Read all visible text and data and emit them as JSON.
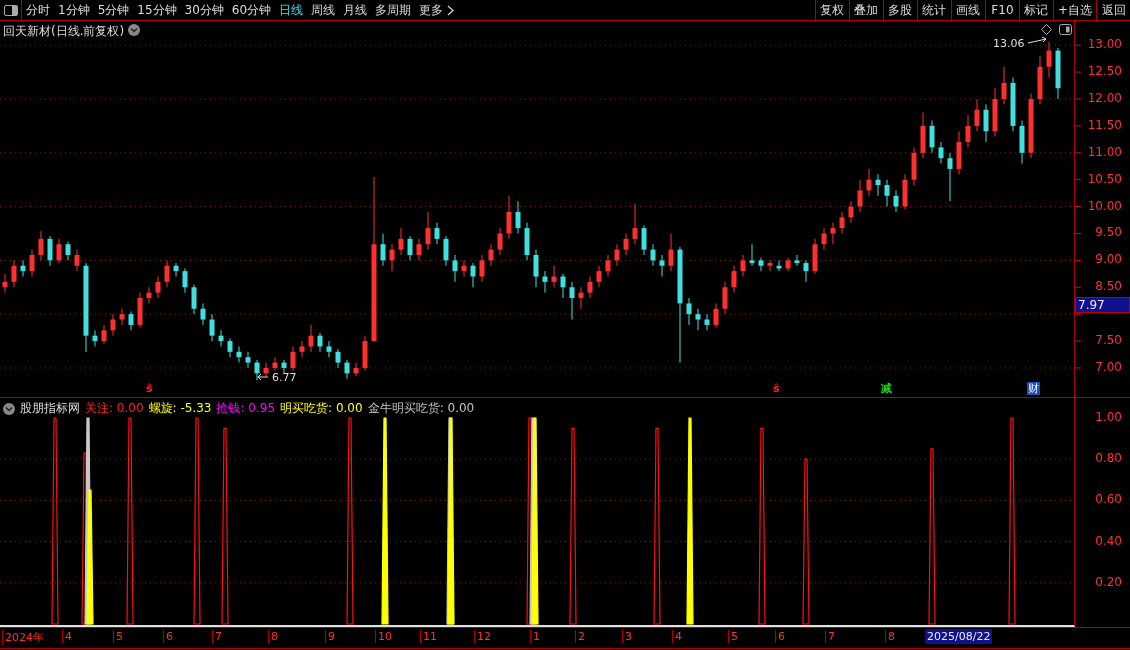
{
  "toolbar": {
    "periods": [
      {
        "label": "分时",
        "selected": false
      },
      {
        "label": "1分钟",
        "selected": false
      },
      {
        "label": "5分钟",
        "selected": false
      },
      {
        "label": "15分钟",
        "selected": false
      },
      {
        "label": "30分钟",
        "selected": false
      },
      {
        "label": "60分钟",
        "selected": false
      },
      {
        "label": "日线",
        "selected": true
      },
      {
        "label": "周线",
        "selected": false
      },
      {
        "label": "月线",
        "selected": false
      },
      {
        "label": "多周期",
        "selected": false
      }
    ],
    "more": "更多",
    "actions": [
      "复权",
      "叠加",
      "多股",
      "统计",
      "画线",
      "F10",
      "标记",
      "+自选",
      "返回"
    ]
  },
  "price_chart": {
    "title": "回天新材(日线.前复权)",
    "chart_data": {
      "type": "candlestick",
      "ylim": [
        6.46,
        13.45
      ],
      "grid": true,
      "yticks": [
        {
          "value": 13,
          "label": "13.00"
        },
        {
          "value": 12.5,
          "label": "12.50"
        },
        {
          "value": 12,
          "label": "12.00"
        },
        {
          "value": 11.5,
          "label": "11.50"
        },
        {
          "value": 11,
          "label": "11.00"
        },
        {
          "value": 10.5,
          "label": "10.50"
        },
        {
          "value": 10,
          "label": "10.00"
        },
        {
          "value": 9.5,
          "label": "9.50"
        },
        {
          "value": 9,
          "label": "9.00"
        },
        {
          "value": 8.5,
          "label": "8.50"
        },
        {
          "value": 7.5,
          "label": "7.50"
        },
        {
          "value": 7,
          "label": "7.00"
        }
      ],
      "ohlc": [
        [
          8.5,
          8.75,
          8.4,
          8.6
        ],
        [
          8.6,
          9.0,
          8.5,
          8.9
        ],
        [
          8.9,
          9.0,
          8.7,
          8.8
        ],
        [
          8.8,
          9.2,
          8.7,
          9.1
        ],
        [
          9.1,
          9.55,
          9.0,
          9.4
        ],
        [
          9.4,
          9.45,
          8.9,
          9.0
        ],
        [
          9.0,
          9.4,
          8.95,
          9.3
        ],
        [
          9.3,
          9.35,
          9.0,
          9.1
        ],
        [
          8.9,
          9.2,
          8.8,
          9.1
        ],
        [
          8.9,
          8.95,
          7.3,
          7.6
        ],
        [
          7.6,
          7.7,
          7.4,
          7.5
        ],
        [
          7.5,
          7.8,
          7.45,
          7.7
        ],
        [
          7.7,
          8.0,
          7.6,
          7.9
        ],
        [
          7.9,
          8.1,
          7.8,
          8.0
        ],
        [
          8.0,
          8.05,
          7.7,
          7.8
        ],
        [
          7.8,
          8.4,
          7.75,
          8.3
        ],
        [
          8.3,
          8.5,
          8.2,
          8.4
        ],
        [
          8.4,
          8.7,
          8.3,
          8.6
        ],
        [
          8.6,
          9.0,
          8.5,
          8.9
        ],
        [
          8.9,
          8.95,
          8.7,
          8.8
        ],
        [
          8.8,
          8.85,
          8.4,
          8.5
        ],
        [
          8.5,
          8.55,
          8.0,
          8.1
        ],
        [
          8.1,
          8.2,
          7.8,
          7.9
        ],
        [
          7.9,
          8.0,
          7.5,
          7.6
        ],
        [
          7.6,
          7.7,
          7.4,
          7.5
        ],
        [
          7.5,
          7.55,
          7.2,
          7.3
        ],
        [
          7.3,
          7.4,
          7.1,
          7.2
        ],
        [
          7.2,
          7.3,
          7.0,
          7.1
        ],
        [
          7.1,
          7.15,
          6.77,
          6.9
        ],
        [
          6.9,
          7.1,
          6.85,
          7.0
        ],
        [
          7.0,
          7.2,
          6.95,
          7.1
        ],
        [
          7.1,
          7.15,
          6.9,
          7.0
        ],
        [
          7.0,
          7.4,
          6.95,
          7.3
        ],
        [
          7.3,
          7.5,
          7.2,
          7.4
        ],
        [
          7.4,
          7.8,
          7.3,
          7.6
        ],
        [
          7.6,
          7.65,
          7.3,
          7.4
        ],
        [
          7.4,
          7.5,
          7.2,
          7.3
        ],
        [
          7.3,
          7.35,
          7.0,
          7.1
        ],
        [
          7.1,
          7.15,
          6.8,
          6.9
        ],
        [
          6.9,
          7.1,
          6.85,
          7.0
        ],
        [
          7.0,
          7.6,
          6.95,
          7.5
        ],
        [
          7.5,
          10.55,
          7.5,
          9.3
        ],
        [
          9.3,
          9.5,
          8.9,
          9.0
        ],
        [
          9.0,
          9.3,
          8.8,
          9.2
        ],
        [
          9.2,
          9.6,
          9.1,
          9.4
        ],
        [
          9.4,
          9.45,
          9.0,
          9.1
        ],
        [
          9.1,
          9.4,
          9.0,
          9.3
        ],
        [
          9.3,
          9.9,
          9.2,
          9.6
        ],
        [
          9.6,
          9.7,
          9.3,
          9.4
        ],
        [
          9.4,
          9.45,
          8.9,
          9.0
        ],
        [
          9.0,
          9.1,
          8.6,
          8.8
        ],
        [
          8.8,
          9.0,
          8.7,
          8.9
        ],
        [
          8.9,
          8.95,
          8.5,
          8.7
        ],
        [
          8.7,
          9.1,
          8.6,
          9.0
        ],
        [
          9.0,
          9.3,
          8.9,
          9.2
        ],
        [
          9.2,
          9.6,
          9.1,
          9.5
        ],
        [
          9.5,
          10.2,
          9.4,
          9.9
        ],
        [
          9.9,
          10.1,
          9.5,
          9.6
        ],
        [
          9.6,
          9.7,
          9.0,
          9.1
        ],
        [
          9.1,
          9.2,
          8.5,
          8.7
        ],
        [
          8.7,
          8.8,
          8.4,
          8.6
        ],
        [
          8.6,
          8.9,
          8.5,
          8.7
        ],
        [
          8.7,
          8.75,
          8.3,
          8.5
        ],
        [
          8.5,
          8.6,
          7.9,
          8.3
        ],
        [
          8.3,
          8.5,
          8.1,
          8.4
        ],
        [
          8.4,
          8.7,
          8.3,
          8.6
        ],
        [
          8.6,
          8.9,
          8.5,
          8.8
        ],
        [
          8.8,
          9.1,
          8.7,
          9.0
        ],
        [
          9.0,
          9.3,
          8.9,
          9.2
        ],
        [
          9.2,
          9.5,
          9.1,
          9.4
        ],
        [
          9.4,
          10.05,
          9.3,
          9.6
        ],
        [
          9.6,
          9.65,
          9.1,
          9.2
        ],
        [
          9.2,
          9.3,
          8.9,
          9.0
        ],
        [
          9.0,
          9.1,
          8.7,
          8.9
        ],
        [
          8.9,
          9.5,
          8.8,
          9.2
        ],
        [
          9.2,
          9.25,
          7.1,
          8.2
        ],
        [
          8.2,
          8.3,
          7.8,
          8.0
        ],
        [
          8.0,
          8.1,
          7.7,
          7.9
        ],
        [
          7.9,
          8.0,
          7.7,
          7.8
        ],
        [
          7.8,
          8.2,
          7.75,
          8.1
        ],
        [
          8.1,
          8.6,
          8.0,
          8.5
        ],
        [
          8.5,
          8.9,
          8.4,
          8.8
        ],
        [
          8.8,
          9.1,
          8.7,
          9.0
        ],
        [
          9.0,
          9.3,
          8.9,
          8.95
        ],
        [
          9.0,
          9.05,
          8.8,
          8.9
        ],
        [
          8.9,
          9.0,
          8.8,
          8.95
        ],
        [
          8.9,
          9.0,
          8.8,
          8.85
        ],
        [
          8.85,
          9.05,
          8.8,
          9.0
        ],
        [
          9.0,
          9.1,
          8.9,
          8.95
        ],
        [
          8.95,
          9.0,
          8.6,
          8.8
        ],
        [
          8.8,
          9.4,
          8.75,
          9.3
        ],
        [
          9.3,
          9.6,
          9.2,
          9.5
        ],
        [
          9.5,
          9.7,
          9.3,
          9.6
        ],
        [
          9.6,
          9.9,
          9.5,
          9.8
        ],
        [
          9.8,
          10.1,
          9.7,
          10.0
        ],
        [
          10.0,
          10.5,
          9.9,
          10.3
        ],
        [
          10.3,
          10.7,
          10.2,
          10.5
        ],
        [
          10.5,
          10.6,
          10.2,
          10.4
        ],
        [
          10.4,
          10.5,
          10.0,
          10.2
        ],
        [
          10.2,
          10.3,
          9.9,
          10.0
        ],
        [
          10.0,
          10.6,
          9.95,
          10.5
        ],
        [
          10.5,
          11.1,
          10.4,
          11.0
        ],
        [
          11.0,
          11.75,
          10.9,
          11.5
        ],
        [
          11.5,
          11.6,
          11.0,
          11.1
        ],
        [
          11.1,
          11.2,
          10.8,
          10.9
        ],
        [
          10.9,
          11.0,
          10.1,
          10.7
        ],
        [
          10.7,
          11.4,
          10.6,
          11.2
        ],
        [
          11.2,
          11.7,
          11.1,
          11.5
        ],
        [
          11.5,
          12.0,
          11.4,
          11.8
        ],
        [
          11.8,
          11.9,
          11.2,
          11.4
        ],
        [
          11.4,
          12.2,
          11.3,
          12.0
        ],
        [
          12.0,
          12.6,
          11.9,
          12.3
        ],
        [
          12.3,
          12.4,
          11.4,
          11.5
        ],
        [
          11.5,
          11.6,
          10.8,
          11.0
        ],
        [
          11.0,
          12.1,
          10.9,
          12.0
        ],
        [
          12.0,
          12.8,
          11.9,
          12.6
        ],
        [
          12.6,
          13.06,
          12.4,
          12.9
        ],
        [
          12.9,
          12.95,
          12.0,
          12.2
        ]
      ]
    },
    "current_price": "7.97",
    "low_label": "6.77",
    "high_label": "13.06",
    "markers": [
      {
        "label": "ŝ",
        "kind": "sell"
      },
      {
        "label": "ŝ",
        "kind": "sell"
      },
      {
        "label": "减",
        "kind": "reduce"
      },
      {
        "label": "财",
        "kind": "finance"
      }
    ]
  },
  "indicator": {
    "name": "股朋指标网",
    "values": [
      {
        "text": "关注: 0.00",
        "color": "#ff2020"
      },
      {
        "text": "螺旋: -5.33",
        "color": "#ffff00"
      },
      {
        "text": "抢钱: 0.95",
        "color": "#ff00ff"
      },
      {
        "text": "明买吃货: 0.00",
        "color": "#ffff00"
      },
      {
        "text": "金牛明买吃货: 0.00",
        "color": "#c0c0c0"
      }
    ],
    "yticks": [
      "1.00",
      "0.80",
      "0.60",
      "0.40",
      "0.20"
    ]
  },
  "date_axis": [
    "2024年",
    "4",
    "5",
    "6",
    "7",
    "8",
    "9",
    "10",
    "11",
    "12",
    "1",
    "2",
    "3",
    "4",
    "5",
    "6",
    "7",
    "8"
  ],
  "date_cursor": "2025/08/22"
}
